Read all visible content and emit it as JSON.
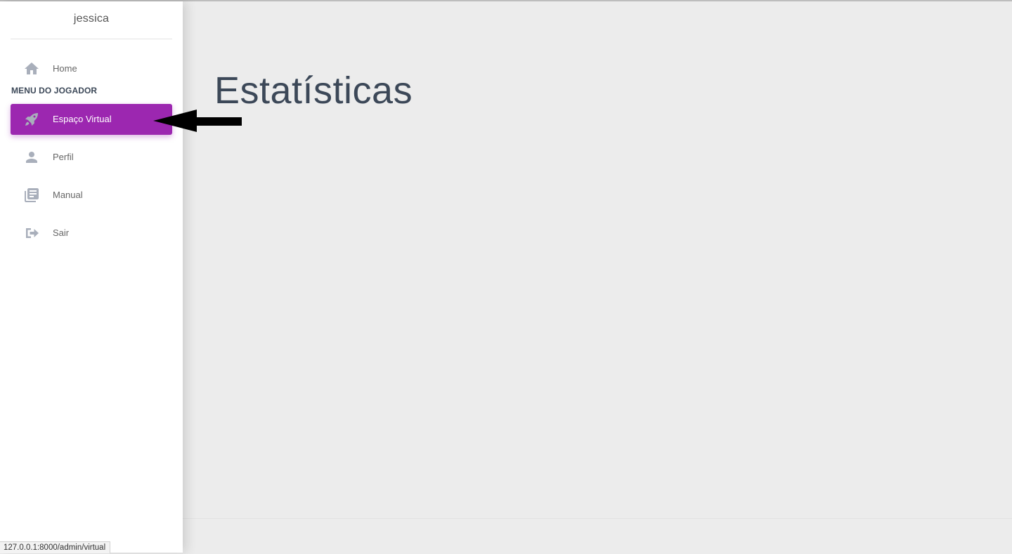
{
  "sidebar": {
    "user_name": "jessica",
    "home_label": "Home",
    "section_title": "MENU DO JOGADOR",
    "items": [
      {
        "label": "Espaço Virtual",
        "icon": "rocket-icon",
        "active": true
      },
      {
        "label": "Perfil",
        "icon": "person-icon"
      },
      {
        "label": "Manual",
        "icon": "library-books-icon"
      },
      {
        "label": "Sair",
        "icon": "exit-icon"
      }
    ]
  },
  "main": {
    "title": "Estatísticas"
  },
  "status_bar": {
    "url": "127.0.0.1:8000/admin/virtual"
  },
  "colors": {
    "accent": "#9c27b0",
    "icon": "#a9afbb",
    "title": "#3c4858",
    "background": "#ececec"
  }
}
